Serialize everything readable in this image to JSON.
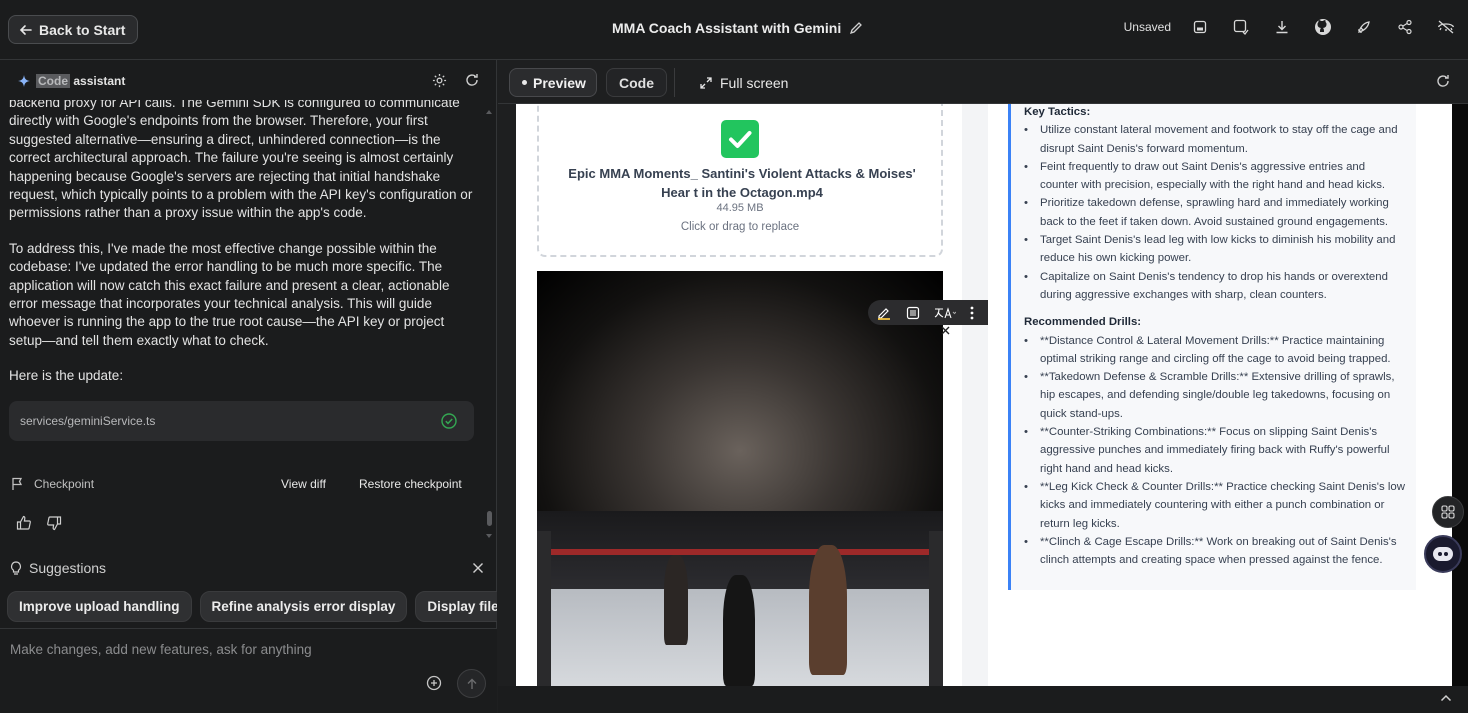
{
  "topbar": {
    "back_label": "Back to Start",
    "title": "MMA Coach Assistant with Gemini",
    "status": "Unsaved"
  },
  "assistant": {
    "title_code": "Code",
    "title_rest": "assistant",
    "messages": [
      "backend proxy for API calls. The Gemini SDK is configured to communicate directly with Google's endpoints from the browser. Therefore, your first suggested alternative—ensuring a direct, unhindered connection—is the correct architectural approach. The failure you're seeing is almost certainly happening because Google's servers are rejecting that initial handshake request, which typically points to a problem with the API key's configuration or permissions rather than a proxy issue within the app's code.",
      "To address this, I've made the most effective change possible within the codebase: I've updated the error handling to be much more specific. The application will now catch this exact failure and present a clear, actionable error message that incorporates your technical analysis. This will guide whoever is running the app to the true root cause—the API key or project setup—and tell them exactly what to check.",
      "Here is the update:"
    ],
    "file_card": "services/geminiService.ts",
    "checkpoint_label": "Checkpoint",
    "view_diff": "View diff",
    "restore_checkpoint": "Restore checkpoint",
    "suggestions_label": "Suggestions",
    "suggestions": [
      "Improve upload handling",
      "Refine analysis error display",
      "Display file si"
    ],
    "input_placeholder": "Make changes, add new features, ask for anything"
  },
  "preview_tabs": {
    "preview": "Preview",
    "code": "Code",
    "full_screen": "Full screen"
  },
  "upload": {
    "file_name": "Epic MMA Moments_ Santini's Violent Attacks & Moises' Hear t in the Octagon.mp4",
    "file_size": "44.95 MB",
    "replace_hint": "Click or drag to replace"
  },
  "analysis": {
    "tactics_title": "Key Tactics:",
    "tactics": [
      "Utilize constant lateral movement and footwork to stay off the cage and disrupt Saint Denis's forward momentum.",
      "Feint frequently to draw out Saint Denis's aggressive entries and counter with precision, especially with the right hand and head kicks.",
      "Prioritize takedown defense, sprawling hard and immediately working back to the feet if taken down. Avoid sustained ground engagements.",
      "Target Saint Denis's lead leg with low kicks to diminish his mobility and reduce his own kicking power.",
      "Capitalize on Saint Denis's tendency to drop his hands or overextend during aggressive exchanges with sharp, clean counters."
    ],
    "drills_title": "Recommended Drills:",
    "drills": [
      "**Distance Control & Lateral Movement Drills:** Practice maintaining optimal striking range and circling off the cage to avoid being trapped.",
      "**Takedown Defense & Scramble Drills:** Extensive drilling of sprawls, hip escapes, and defending single/double leg takedowns, focusing on quick stand-ups.",
      "**Counter-Striking Combinations:** Focus on slipping Saint Denis's aggressive punches and immediately firing back with Ruffy's powerful right hand and head kicks.",
      "**Leg Kick Check & Counter Drills:** Practice checking Saint Denis's low kicks and immediately countering with either a punch combination or return leg kicks.",
      "**Clinch & Cage Escape Drills:** Work on breaking out of Saint Denis's clinch attempts and creating space when pressed against the fence."
    ]
  },
  "colors": {
    "accent": "#3b82f6",
    "success": "#22c55e",
    "panel_bg": "#1b1c1d"
  },
  "icons": [
    "arrow-left-icon",
    "pencil-icon",
    "save-icon",
    "save-as-icon",
    "download-icon",
    "github-icon",
    "rocket-icon",
    "share-icon",
    "eye-off-icon",
    "sparkle-icon",
    "settings-icon",
    "refresh-icon",
    "check-circle-icon",
    "flag-icon",
    "thumb-up-icon",
    "thumb-down-icon",
    "lightbulb-icon",
    "close-icon",
    "add-circle-icon",
    "arrow-up-icon",
    "expand-icon",
    "chevron-up-icon"
  ]
}
